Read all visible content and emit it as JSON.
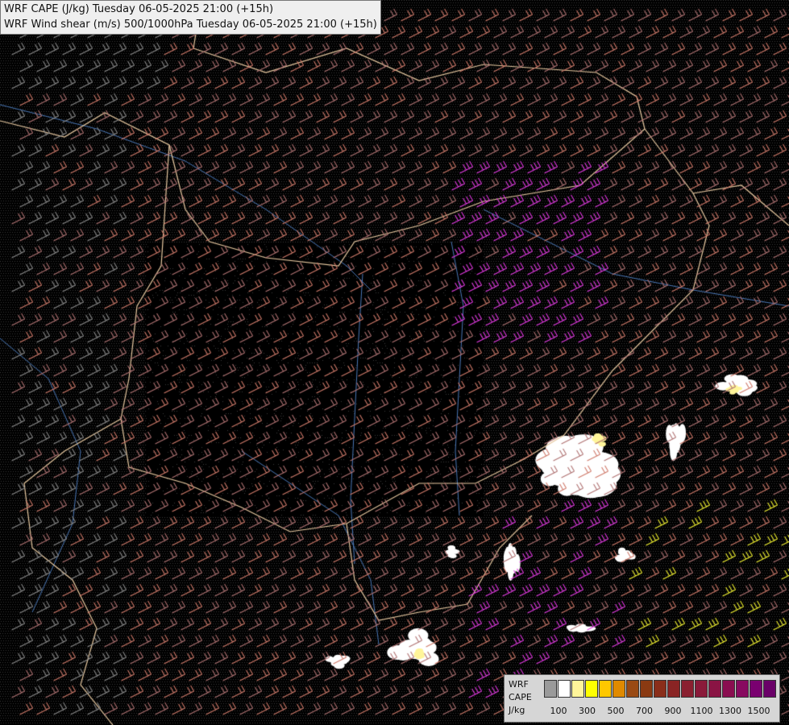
{
  "header": {
    "line1": "WRF CAPE (J/kg) Tuesday 06-05-2025 21:00 (+15h)",
    "line2": "WRF Wind shear (m/s) 500/1000hPa Tuesday 06-05-2025 21:00 (+15h)"
  },
  "legend": {
    "label_1": "WRF",
    "label_2": "CAPE",
    "label_3": "J/kg",
    "colors": [
      "#9a9a9a",
      "#ffffff",
      "#fff59a",
      "#ffff00",
      "#ffc800",
      "#e08a00",
      "#9a4a14",
      "#8a3a12",
      "#8a2e1a",
      "#8a2424",
      "#8a2030",
      "#8a1a3a",
      "#8a1444",
      "#8a0e50",
      "#880a60",
      "#7a0070",
      "#6a0068"
    ],
    "ticks": [
      "100",
      "300",
      "500",
      "700",
      "900",
      "1100",
      "1300",
      "1500"
    ]
  },
  "map": {
    "background": "#000000",
    "barb_colors": [
      "#8a8a8a",
      "#b07272",
      "#d07a6a",
      "#e23ae2",
      "#f2f230"
    ],
    "boundary_color": "#e8c9a0",
    "river_color": "#4a78b8"
  }
}
